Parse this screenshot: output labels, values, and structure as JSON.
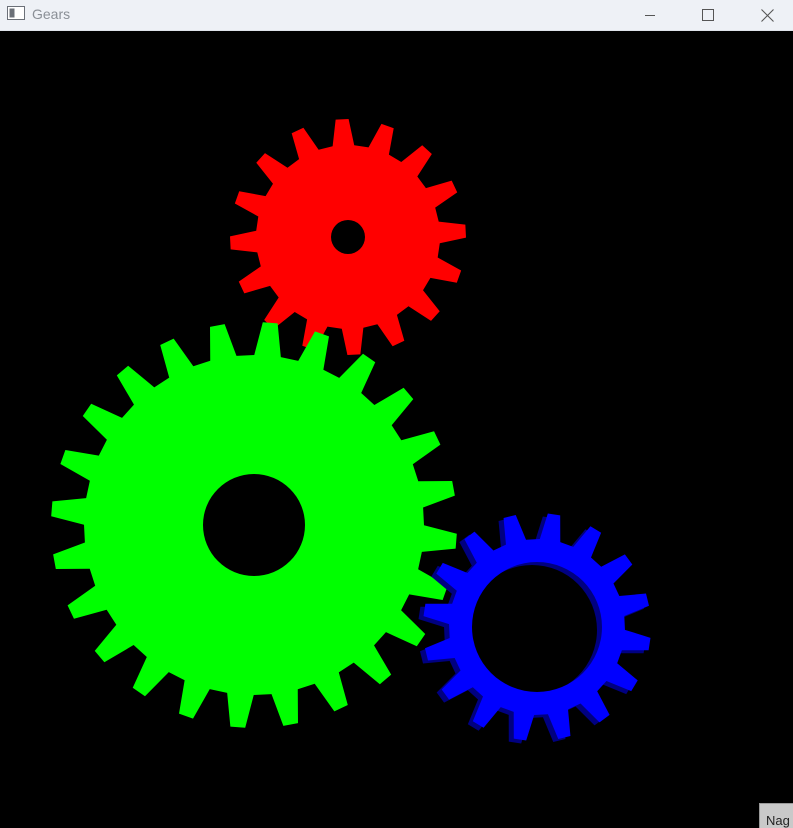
{
  "window": {
    "title": "Gears",
    "buttons": {
      "minimize": "minimize-icon",
      "maximize": "maximize-icon",
      "close": "close-icon"
    }
  },
  "scene": {
    "background_color": "#000000",
    "gears": [
      {
        "name": "red-gear",
        "color": "#ff0000",
        "teeth": 16
      },
      {
        "name": "green-gear",
        "color": "#00ff00",
        "teeth": 24
      },
      {
        "name": "blue-gear",
        "color": "#0000ff",
        "teeth": 16
      }
    ]
  },
  "corner_tab": {
    "text": "Nag"
  }
}
